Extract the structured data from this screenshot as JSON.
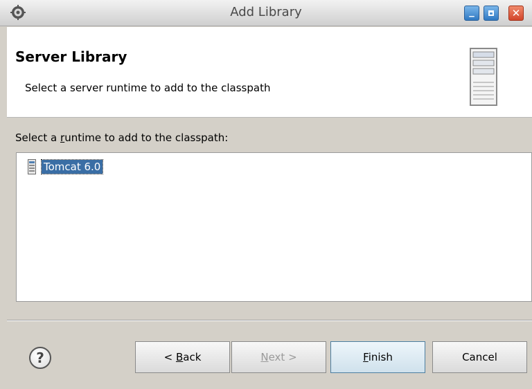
{
  "window": {
    "title": "Add Library",
    "icon": "eclipse-gear-icon",
    "controls": [
      "minimize",
      "maximize",
      "close"
    ]
  },
  "header": {
    "title": "Server Library",
    "description": "Select a server runtime to add to the classpath",
    "icon": "server-icon"
  },
  "runtime_section": {
    "label_prefix": "Select a ",
    "label_mnemonic": "r",
    "label_suffix": "untime to add to the classpath:",
    "runtimes": [
      {
        "name": "Tomcat 6.0",
        "icon": "server-runtime-icon",
        "selected": true
      }
    ]
  },
  "footer": {
    "help_symbol": "?",
    "buttons": {
      "back_prefix": "< ",
      "back_mnemonic": "B",
      "back_suffix": "ack",
      "next_mnemonic": "N",
      "next_suffix": "ext >",
      "finish_mnemonic": "F",
      "finish_suffix": "inish",
      "cancel": "Cancel"
    },
    "next_enabled": false
  }
}
